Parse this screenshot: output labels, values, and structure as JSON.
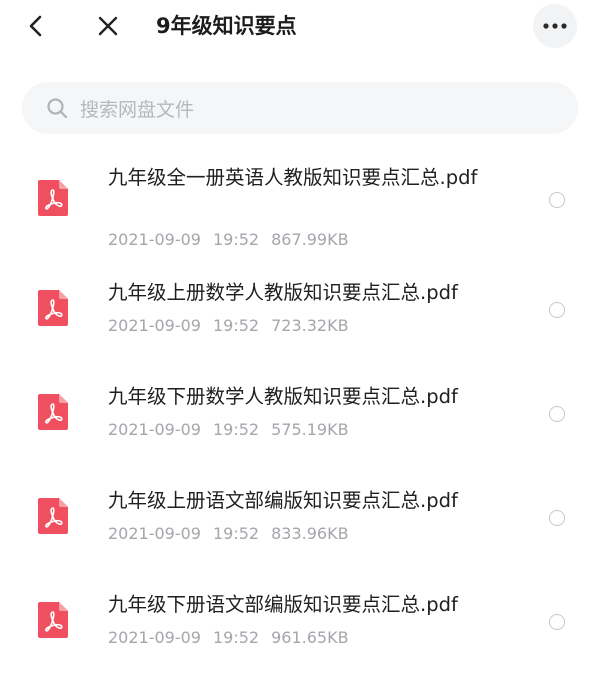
{
  "header": {
    "title": "9年级知识要点"
  },
  "search": {
    "placeholder": "搜索网盘文件"
  },
  "files": [
    {
      "name": "九年级全一册英语人教版知识要点汇总.pdf",
      "date": "2021-09-09",
      "time": "19:52",
      "size": "867.99KB"
    },
    {
      "name": "九年级上册数学人教版知识要点汇总.pdf",
      "date": "2021-09-09",
      "time": "19:52",
      "size": "723.32KB"
    },
    {
      "name": "九年级下册数学人教版知识要点汇总.pdf",
      "date": "2021-09-09",
      "time": "19:52",
      "size": "575.19KB"
    },
    {
      "name": "九年级上册语文部编版知识要点汇总.pdf",
      "date": "2021-09-09",
      "time": "19:52",
      "size": "833.96KB"
    },
    {
      "name": "九年级下册语文部编版知识要点汇总.pdf",
      "date": "2021-09-09",
      "time": "19:52",
      "size": "961.65KB"
    }
  ],
  "colors": {
    "pdf_icon": "#ef4f5f",
    "meta_text": "#a3a6ab",
    "search_bg": "#f5f6f8"
  },
  "icons": [
    "back-arrow-icon",
    "close-icon",
    "more-icon",
    "search-icon",
    "pdf-file-icon"
  ]
}
